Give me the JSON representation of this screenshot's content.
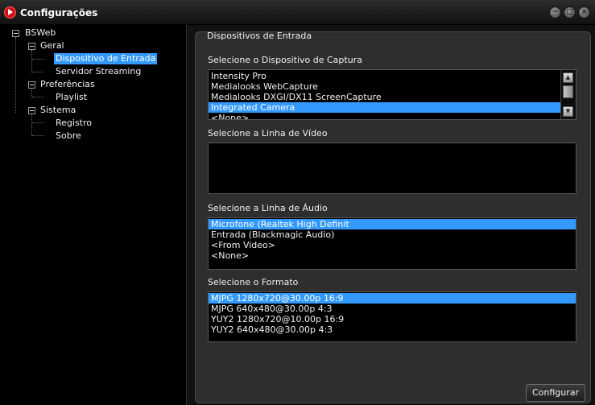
{
  "window": {
    "title": "Configurações"
  },
  "tree": {
    "root": "BSWeb",
    "geral": "Geral",
    "dispositivo": "Dispositivo de Entrada",
    "servidor": "Servidor Streaming",
    "preferencias": "Preferências",
    "playlist": "Playlist",
    "sistema": "Sistema",
    "registro": "Registro",
    "sobre": "Sobre"
  },
  "panel": {
    "title": "Dispositivos de Entrada",
    "capture": {
      "label": "Selecione o Dispositivo de Captura",
      "options": [
        "Intensity Pro",
        "Medialooks WebCapture",
        "Medialooks DXGI/DX11 ScreenCapture",
        "Integrated Camera",
        "<None>"
      ],
      "selected": "Integrated Camera"
    },
    "video": {
      "label": "Selecione a Linha de Vídeo",
      "options": []
    },
    "audio": {
      "label": "Selecione a Linha de Áudio",
      "options": [
        "Microfone (Realtek High Definit",
        "Entrada (Blackmagic Audio)",
        "<From Video>",
        "<None>"
      ],
      "selected": "Microfone (Realtek High Definit"
    },
    "format": {
      "label": "Selecione o Formato",
      "options": [
        "MJPG 1280x720@30.00p 16:9",
        "MJPG 640x480@30.00p 4:3",
        "YUY2 1280x720@10.00p 16:9",
        "YUY2 640x480@30.00p 4:3"
      ],
      "selected": "MJPG 1280x720@30.00p 16:9"
    },
    "configure_label": "Configurar"
  },
  "icons": {
    "app": "app-play-icon",
    "minimize": "minimize-icon",
    "maximize": "maximize-icon",
    "close": "close-icon"
  },
  "colors": {
    "selection": "#3399ff",
    "app_icon": "#d01010"
  }
}
